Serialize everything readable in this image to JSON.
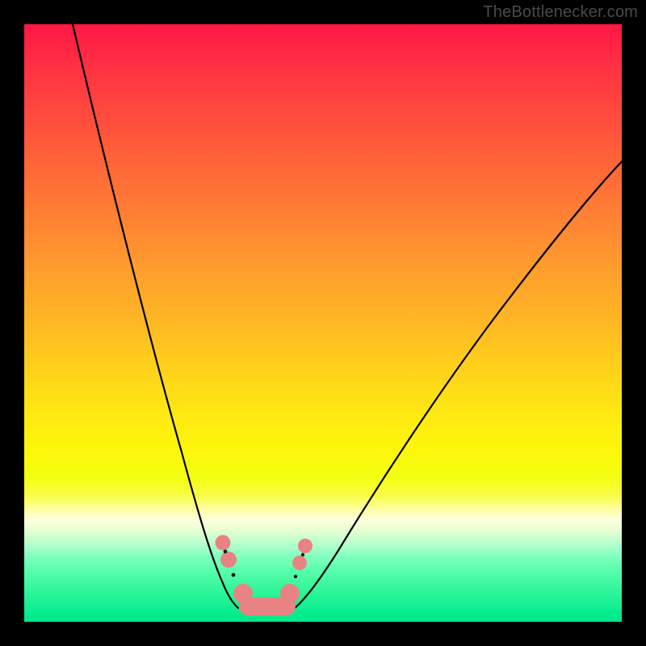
{
  "watermark": "TheBottlenecker.com",
  "chart_data": {
    "type": "line",
    "title": "",
    "xlabel": "",
    "ylabel": "",
    "xlim": [
      0,
      100
    ],
    "ylim": [
      0,
      100
    ],
    "background_gradient": {
      "stops": [
        {
          "pos": 0,
          "color": "#ff1744"
        },
        {
          "pos": 50,
          "color": "#ffd21a"
        },
        {
          "pos": 83,
          "color": "#ffffe0"
        },
        {
          "pos": 100,
          "color": "#00e888"
        }
      ],
      "meaning": "top=red (bad), bottom=green (good)"
    },
    "series": [
      {
        "name": "left-branch",
        "x": [
          8,
          14,
          21,
          27,
          31,
          34,
          36
        ],
        "y": [
          100,
          75,
          45,
          22,
          10,
          4,
          1
        ]
      },
      {
        "name": "right-branch",
        "x": [
          45,
          50,
          58,
          68,
          80,
          92,
          100
        ],
        "y": [
          1,
          5,
          14,
          28,
          45,
          62,
          73
        ]
      }
    ],
    "markers": {
      "name": "trough-highlight",
      "shape": "beaded-U",
      "color": "#e98383",
      "approx_points": [
        {
          "x": 33,
          "y": 13
        },
        {
          "x": 34,
          "y": 10
        },
        {
          "x": 37,
          "y": 3
        },
        {
          "x": 40,
          "y": 1
        },
        {
          "x": 43,
          "y": 3
        },
        {
          "x": 46,
          "y": 10
        },
        {
          "x": 47,
          "y": 13
        }
      ]
    },
    "notes": "V-shaped bottleneck curve on rainbow vertical gradient; minimum sits in green zone near x≈40."
  }
}
